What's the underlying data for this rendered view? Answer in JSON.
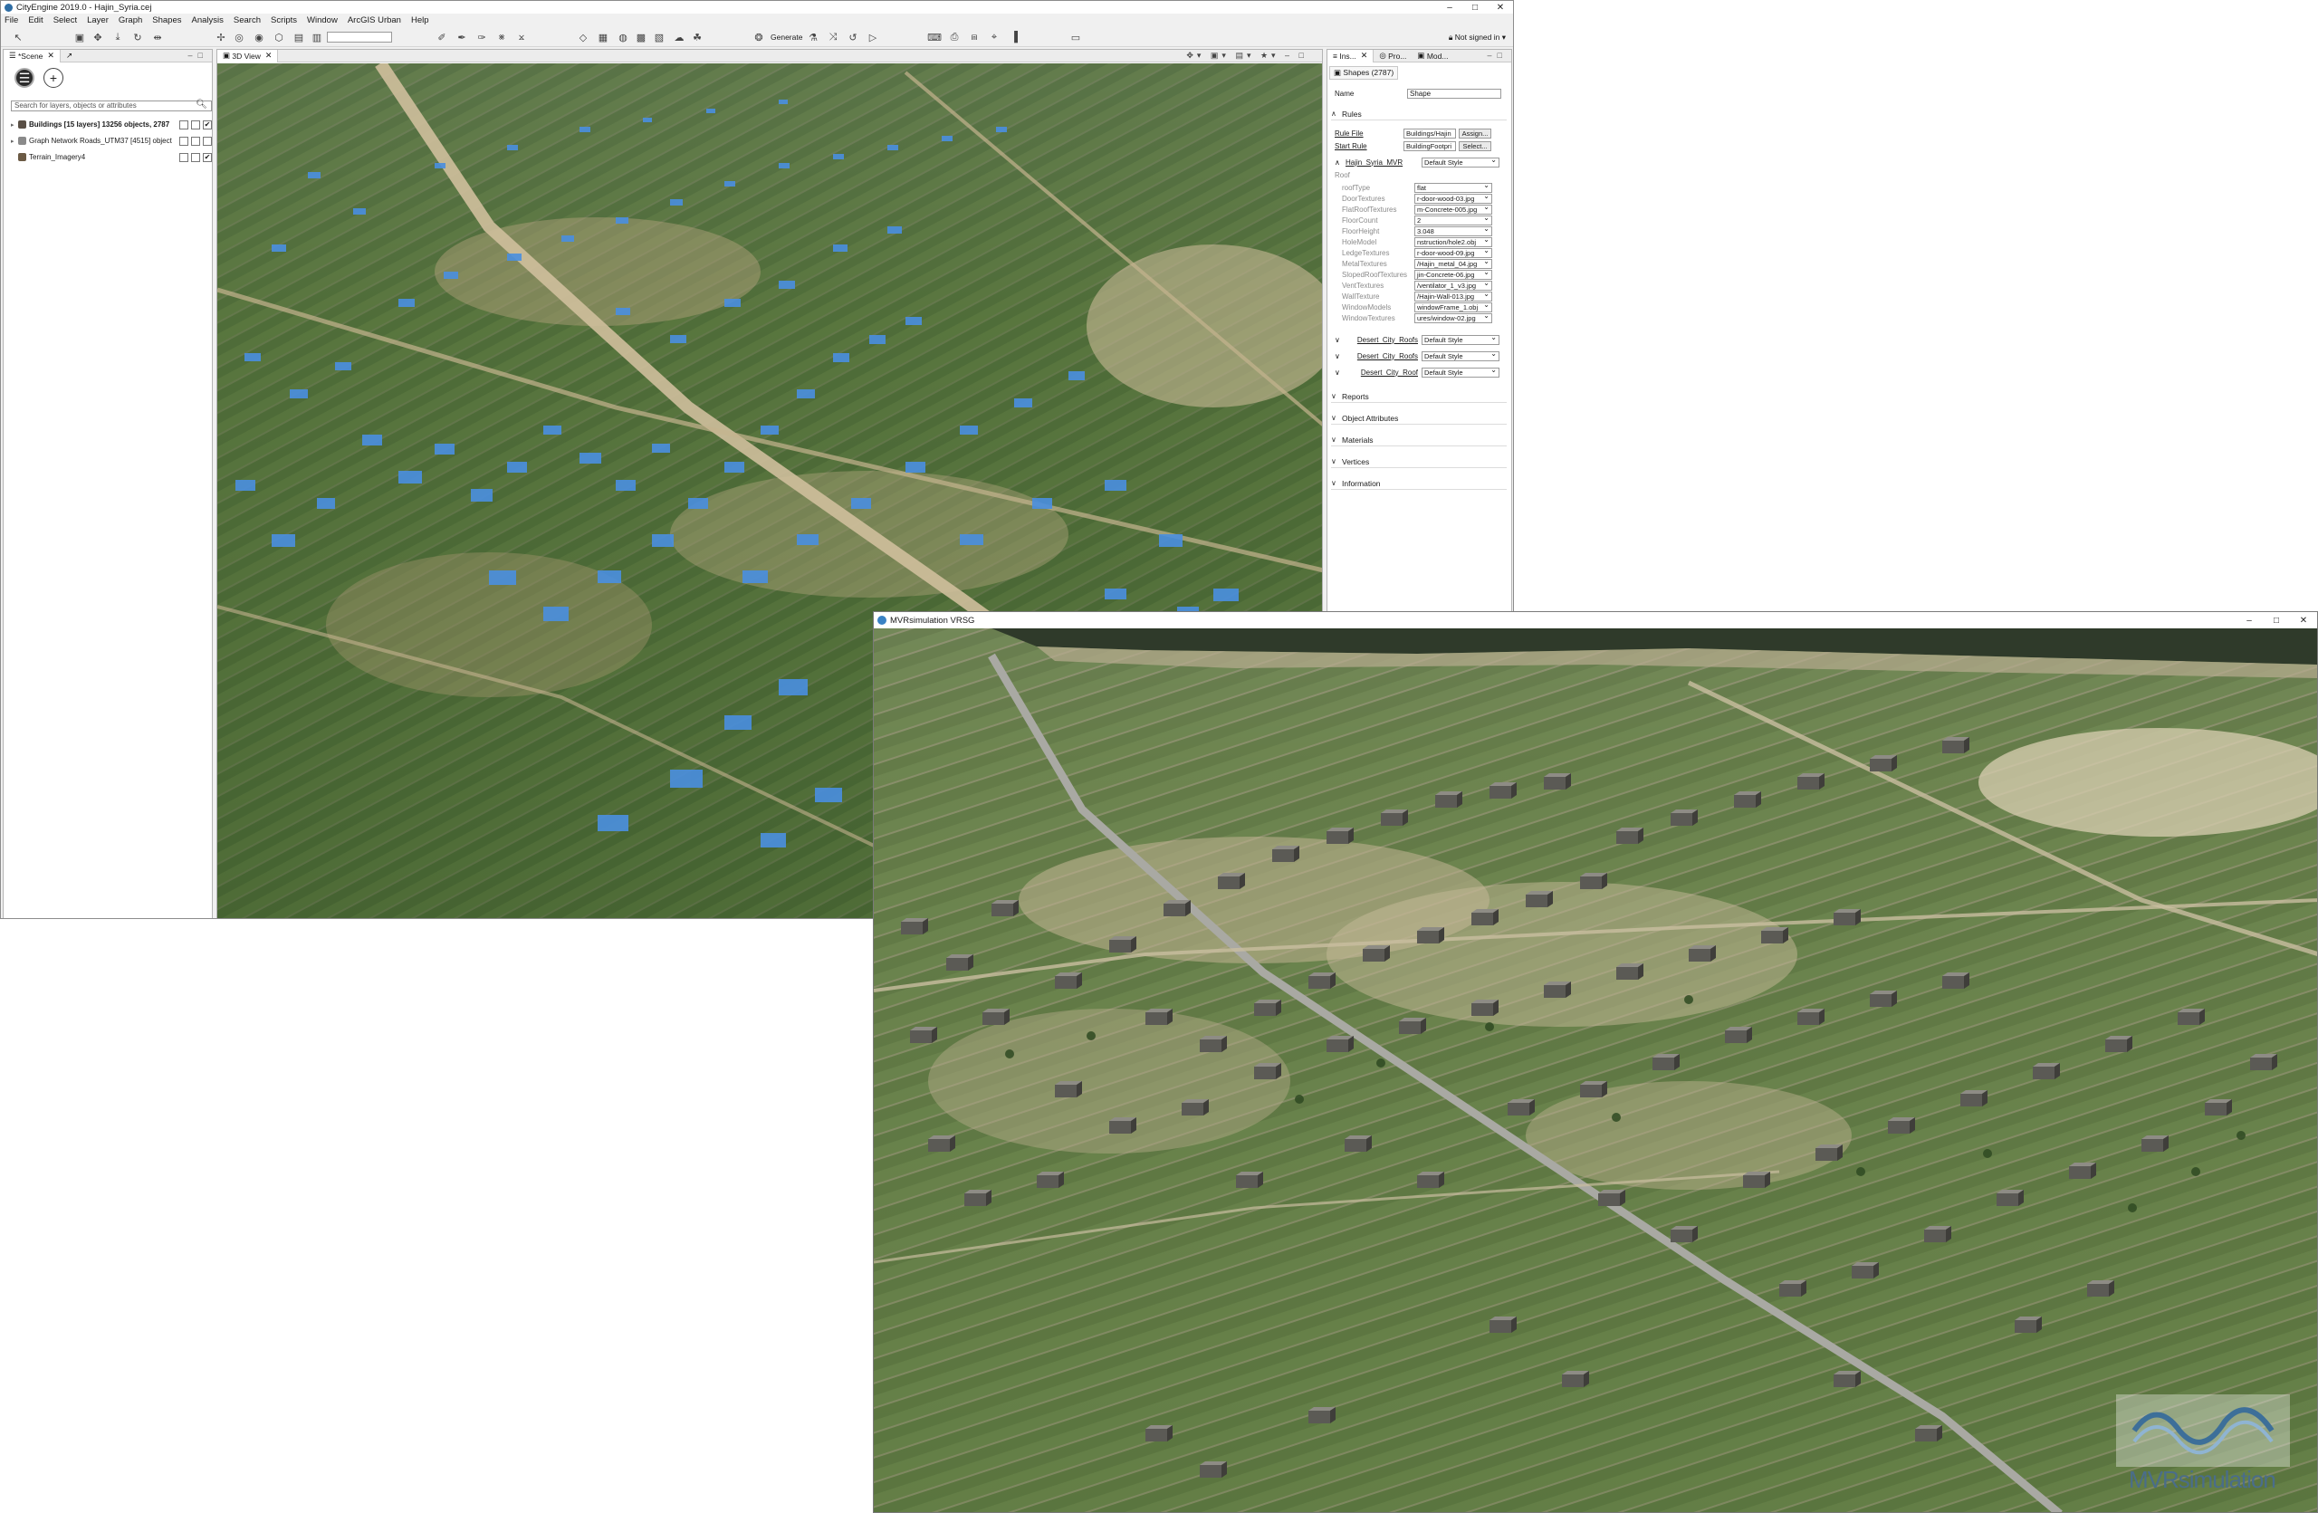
{
  "cityengine": {
    "title": "CityEngine 2019.0 - Hajin_Syria.cej",
    "window_controls": [
      "–",
      "□",
      "✕"
    ],
    "menu": [
      "File",
      "Edit",
      "Select",
      "Layer",
      "Graph",
      "Shapes",
      "Analysis",
      "Search",
      "Scripts",
      "Window",
      "ArcGIS Urban",
      "Help"
    ],
    "toolbar": {
      "generate_label": "Generate",
      "sign_in_label": "Not signed in"
    },
    "scene_panel": {
      "tab_label": "*Scene",
      "search_placeholder": "Search for layers, objects or attributes",
      "layers": [
        {
          "name": "Buildings [15 layers] 13256 objects, 2787",
          "bold": true,
          "checked": true
        },
        {
          "name": "Graph Network Roads_UTM37 [4515] object",
          "bold": false,
          "checked": false
        },
        {
          "name": "Terrain_Imagery4",
          "bold": false,
          "checked": true
        }
      ]
    },
    "view3d": {
      "tab_label": "3D View"
    },
    "inspector": {
      "tabs": [
        "Ins...",
        "Pro...",
        "Mod..."
      ],
      "subtab": "Shapes (2787)",
      "name_label": "Name",
      "name_value": "Shape",
      "rules_header": "Rules",
      "rule_file_label": "Rule File",
      "rule_file_value": "Buildings/Hajin",
      "assign_label": "Assign...",
      "start_rule_label": "Start Rule",
      "start_rule_value": "BuildingFootpri",
      "select_label": "Select...",
      "style_group": {
        "name": "Hajin_Syria_MVR",
        "style": "Default Style"
      },
      "roof_label": "Roof",
      "attributes": [
        {
          "name": "roofType",
          "value": "flat"
        },
        {
          "name": "DoorTextures",
          "value": "r-door-wood-03.jpg"
        },
        {
          "name": "FlatRoofTextures",
          "value": "m-Concrete-005.jpg"
        },
        {
          "name": "FloorCount",
          "value": "2"
        },
        {
          "name": "FloorHeight",
          "value": "3.048"
        },
        {
          "name": "HoleModel",
          "value": "nstruction/hole2.obj"
        },
        {
          "name": "LedgeTextures",
          "value": "r-door-wood-09.jpg"
        },
        {
          "name": "MetalTextures",
          "value": "/Hajin_metal_04.jpg"
        },
        {
          "name": "SlopedRoofTextures",
          "value": "jin-Concrete-06.jpg"
        },
        {
          "name": "VentTextures",
          "value": "/ventilator_1_v3.jpg"
        },
        {
          "name": "WallTexture",
          "value": "/Hajin-Wall-013.jpg"
        },
        {
          "name": "WindowModels",
          "value": "windowFrame_1.obj"
        },
        {
          "name": "WindowTextures",
          "value": "ures/window-02.jpg"
        }
      ],
      "style_rows": [
        {
          "name": "Desert_City_Roofs",
          "style": "Default Style"
        },
        {
          "name": "Desert_City_Roofs",
          "style": "Default Style"
        },
        {
          "name": "Desert_City_Roof",
          "style": "Default Style"
        }
      ],
      "sections": [
        "Reports",
        "Object Attributes",
        "Materials",
        "Vertices",
        "Information"
      ]
    }
  },
  "mvr": {
    "title": "MVRsimulation VRSG",
    "window_controls": [
      "–",
      "□",
      "✕"
    ],
    "watermark_text": "MVRsimulation"
  },
  "colors": {
    "building_highlight": "#4a8fe0",
    "field_green": "#4f6e38",
    "road_tan": "#c9b795",
    "river_dark": "#2f3a2a"
  }
}
